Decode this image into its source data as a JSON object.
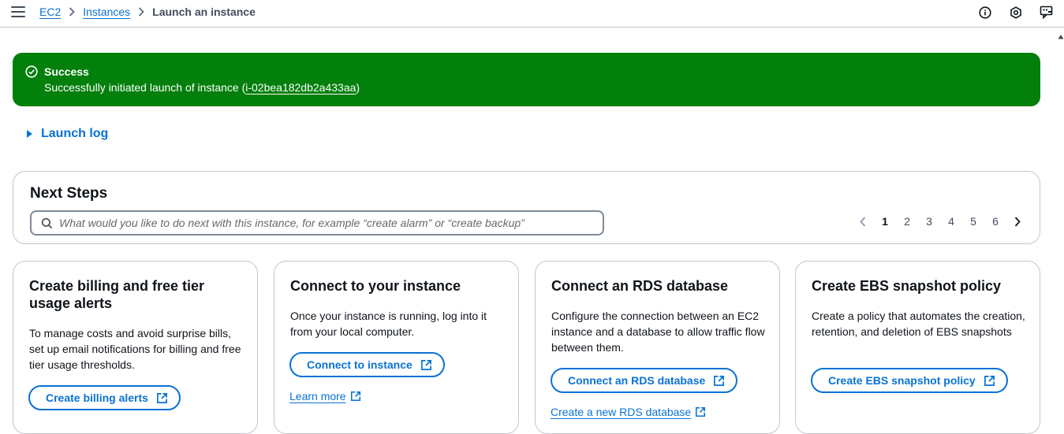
{
  "breadcrumb": {
    "items": [
      "EC2",
      "Instances"
    ],
    "current": "Launch an instance"
  },
  "top_icons": [
    "info-icon",
    "settings-hex-icon",
    "feedback-icon"
  ],
  "flash": {
    "title": "Success",
    "message_prefix": "Successfully initiated launch of instance (",
    "instance_id": "i-02bea182db2a433aa",
    "message_suffix": ")",
    "color": "#037f0c"
  },
  "launch_log": {
    "label": "Launch log"
  },
  "next_steps": {
    "title": "Next Steps",
    "search_placeholder": "What would you like to do next with this instance, for example “create alarm” or “create backup”",
    "pages": [
      "1",
      "2",
      "3",
      "4",
      "5",
      "6"
    ],
    "current_page": "1"
  },
  "cards": [
    {
      "title": "Create billing and free tier usage alerts",
      "description": "To manage costs and avoid surprise bills, set up email notifications for billing and free tier usage thresholds.",
      "button": "Create billing alerts"
    },
    {
      "title": "Connect to your instance",
      "description": "Once your instance is running, log into it from your local computer.",
      "button": "Connect to instance",
      "link": "Learn more"
    },
    {
      "title": "Connect an RDS database",
      "description": "Configure the connection between an EC2 instance and a database to allow traffic flow between them.",
      "button": "Connect an RDS database",
      "link": "Create a new RDS database"
    },
    {
      "title": "Create EBS snapshot policy",
      "description": "Create a policy that automates the creation, retention, and deletion of EBS snapshots",
      "button": "Create EBS snapshot policy"
    }
  ],
  "colors": {
    "link": "#0972d3",
    "success": "#037f0c",
    "border": "#c6c6cd"
  }
}
